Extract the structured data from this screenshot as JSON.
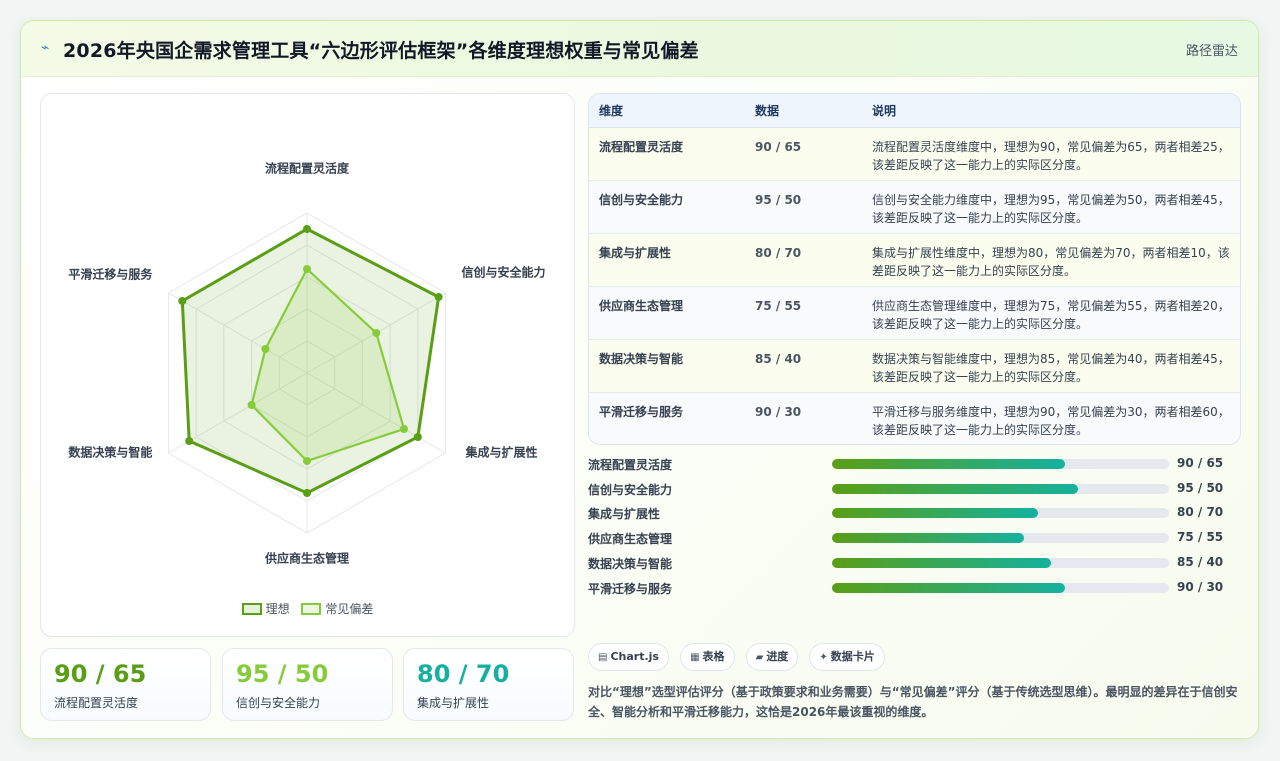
{
  "header": {
    "title": "2026年央国企需求管理工具“六边形评估框架”各维度理想权重与常见偏差",
    "tag": "路径雷达"
  },
  "chart_data": {
    "type": "radar",
    "categories": [
      "流程配置灵活度",
      "信创与安全能力",
      "集成与扩展性",
      "供应商生态管理",
      "数据决策与智能",
      "平滑迁移与服务"
    ],
    "series": [
      {
        "name": "理想",
        "values": [
          90,
          95,
          80,
          75,
          85,
          90
        ],
        "color": "#5a9e16"
      },
      {
        "name": "常见偏差",
        "values": [
          65,
          50,
          70,
          55,
          40,
          30
        ],
        "color": "#86cc3a"
      }
    ],
    "rlim": [
      0,
      100
    ],
    "legend_position": "bottom"
  },
  "stats": [
    {
      "value": "90 / 65",
      "label": "流程配置灵活度",
      "color": "#5a9e16"
    },
    {
      "value": "95 / 50",
      "label": "信创与安全能力",
      "color": "#86cc3a"
    },
    {
      "value": "80 / 70",
      "label": "集成与扩展性",
      "color": "#16b19e"
    }
  ],
  "table": {
    "headers": [
      "维度",
      "数据",
      "说明"
    ],
    "rows": [
      {
        "dim": "流程配置灵活度",
        "data": "90 / 65",
        "desc": "流程配置灵活度维度中，理想为90，常见偏差为65，两者相差25，该差距反映了这一能力上的实际区分度。"
      },
      {
        "dim": "信创与安全能力",
        "data": "95 / 50",
        "desc": "信创与安全能力维度中，理想为95，常见偏差为50，两者相差45，该差距反映了这一能力上的实际区分度。"
      },
      {
        "dim": "集成与扩展性",
        "data": "80 / 70",
        "desc": "集成与扩展性维度中，理想为80，常见偏差为70，两者相差10，该差距反映了这一能力上的实际区分度。"
      },
      {
        "dim": "供应商生态管理",
        "data": "75 / 55",
        "desc": "供应商生态管理维度中，理想为75，常见偏差为55，两者相差20，该差距反映了这一能力上的实际区分度。"
      },
      {
        "dim": "数据决策与智能",
        "data": "85 / 40",
        "desc": "数据决策与智能维度中，理想为85，常见偏差为40，两者相差45，该差距反映了这一能力上的实际区分度。"
      },
      {
        "dim": "平滑迁移与服务",
        "data": "90 / 30",
        "desc": "平滑迁移与服务维度中，理想为90，常见偏差为30，两者相差60，该差距反映了这一能力上的实际区分度。"
      }
    ]
  },
  "progress": [
    {
      "label": "流程配置灵活度",
      "value": "90 / 65",
      "fraction": 0.69
    },
    {
      "label": "信创与安全能力",
      "value": "95 / 50",
      "fraction": 0.73
    },
    {
      "label": "集成与扩展性",
      "value": "80 / 70",
      "fraction": 0.61
    },
    {
      "label": "供应商生态管理",
      "value": "75 / 55",
      "fraction": 0.57
    },
    {
      "label": "数据决策与智能",
      "value": "85 / 40",
      "fraction": 0.65
    },
    {
      "label": "平滑迁移与服务",
      "value": "90 / 30",
      "fraction": 0.69
    }
  ],
  "chips": [
    {
      "icon": "chart-icon",
      "glyph": "▤",
      "label": "Chart.js"
    },
    {
      "icon": "table-icon",
      "glyph": "▦",
      "label": "表格"
    },
    {
      "icon": "progress-icon",
      "glyph": "▰",
      "label": "进度"
    },
    {
      "icon": "card-icon",
      "glyph": "✦",
      "label": "数据卡片"
    }
  ],
  "description": "对比“理想”选型评估评分（基于政策要求和业务需要）与“常见偏差”评分（基于传统选型思维）。最明显的差异在于信创安全、智能分析和平滑迁移能力，这恰是2026年最该重视的维度。"
}
